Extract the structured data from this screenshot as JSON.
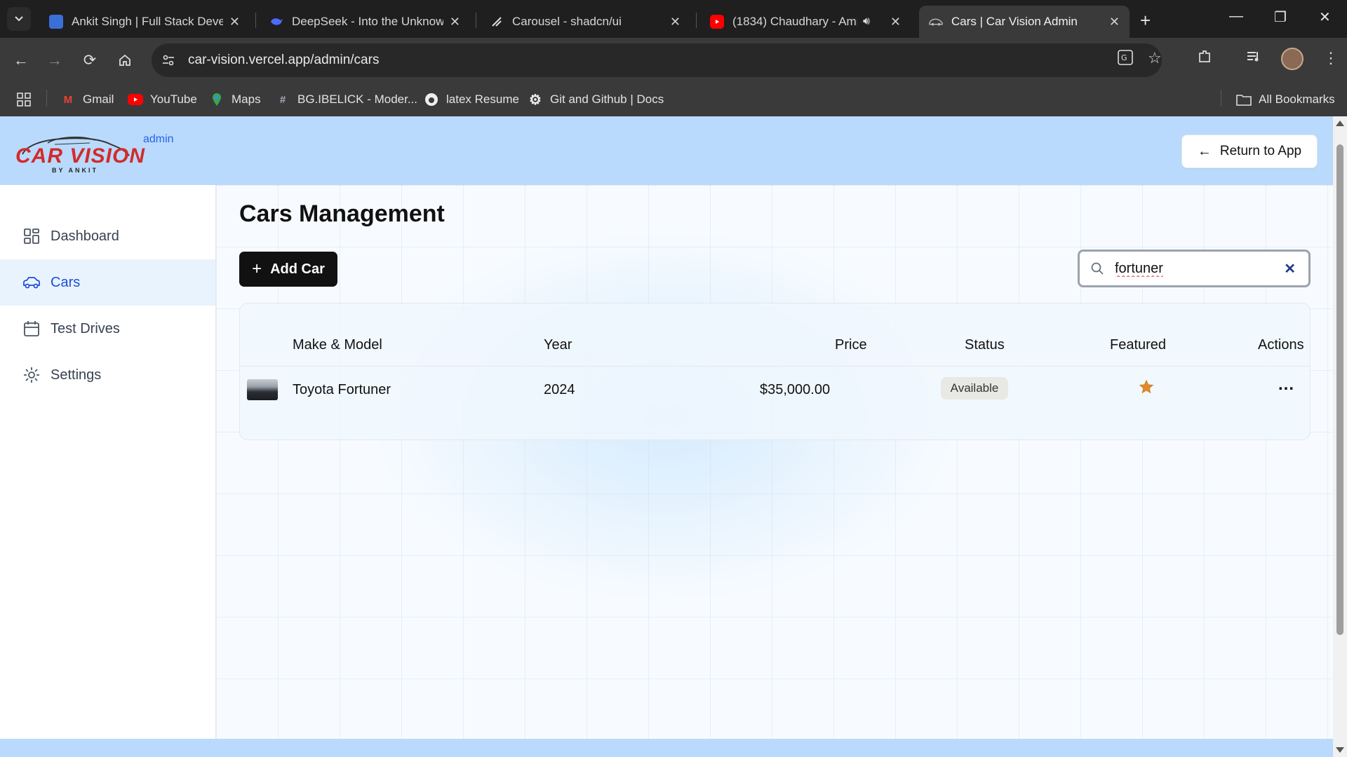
{
  "browser": {
    "tabs": [
      {
        "title": "Ankit Singh | Full Stack Develo",
        "icon": "profile-favicon"
      },
      {
        "title": "DeepSeek - Into the Unknown",
        "icon": "deepseek-favicon"
      },
      {
        "title": "Carousel - shadcn/ui",
        "icon": "shadcn-favicon"
      },
      {
        "title": "(1834) Chaudhary - Amit",
        "icon": "youtube-favicon"
      },
      {
        "title": "Cars | Car Vision Admin",
        "icon": "car-favicon"
      }
    ],
    "url": "car-vision.vercel.app/admin/cars",
    "bookmarks": [
      {
        "label": "Gmail",
        "icon": "gmail-icon"
      },
      {
        "label": "YouTube",
        "icon": "youtube-icon"
      },
      {
        "label": "Maps",
        "icon": "maps-icon"
      },
      {
        "label": "BG.IBELICK - Moder...",
        "icon": "hash-icon"
      },
      {
        "label": "latex Resume",
        "icon": "overleaf-icon"
      },
      {
        "label": "Git and Github | Docs",
        "icon": "gear-icon"
      }
    ],
    "all_bookmarks": "All Bookmarks"
  },
  "header": {
    "logo_text": "CAR VISION",
    "logo_sub": "BY ANKIT",
    "admin_tag": "admin",
    "return_button": "Return to App"
  },
  "sidebar": {
    "items": [
      {
        "label": "Dashboard",
        "icon": "dashboard-icon",
        "active": false
      },
      {
        "label": "Cars",
        "icon": "car-icon",
        "active": true
      },
      {
        "label": "Test Drives",
        "icon": "calendar-icon",
        "active": false
      },
      {
        "label": "Settings",
        "icon": "settings-icon",
        "active": false
      }
    ]
  },
  "main": {
    "title": "Cars Management",
    "add_button": "Add Car",
    "search": {
      "value": "fortuner"
    },
    "table": {
      "columns": [
        "Make & Model",
        "Year",
        "Price",
        "Status",
        "Featured",
        "Actions"
      ],
      "rows": [
        {
          "make_model": "Toyota Fortuner",
          "year": "2024",
          "price": "$35,000.00",
          "status": "Available",
          "featured": true,
          "actions": "..."
        }
      ]
    }
  },
  "colors": {
    "header_bg": "#b9dafc",
    "accent": "#1d4ed8",
    "logo_red": "#d22b2b",
    "star": "#e08a2c"
  }
}
